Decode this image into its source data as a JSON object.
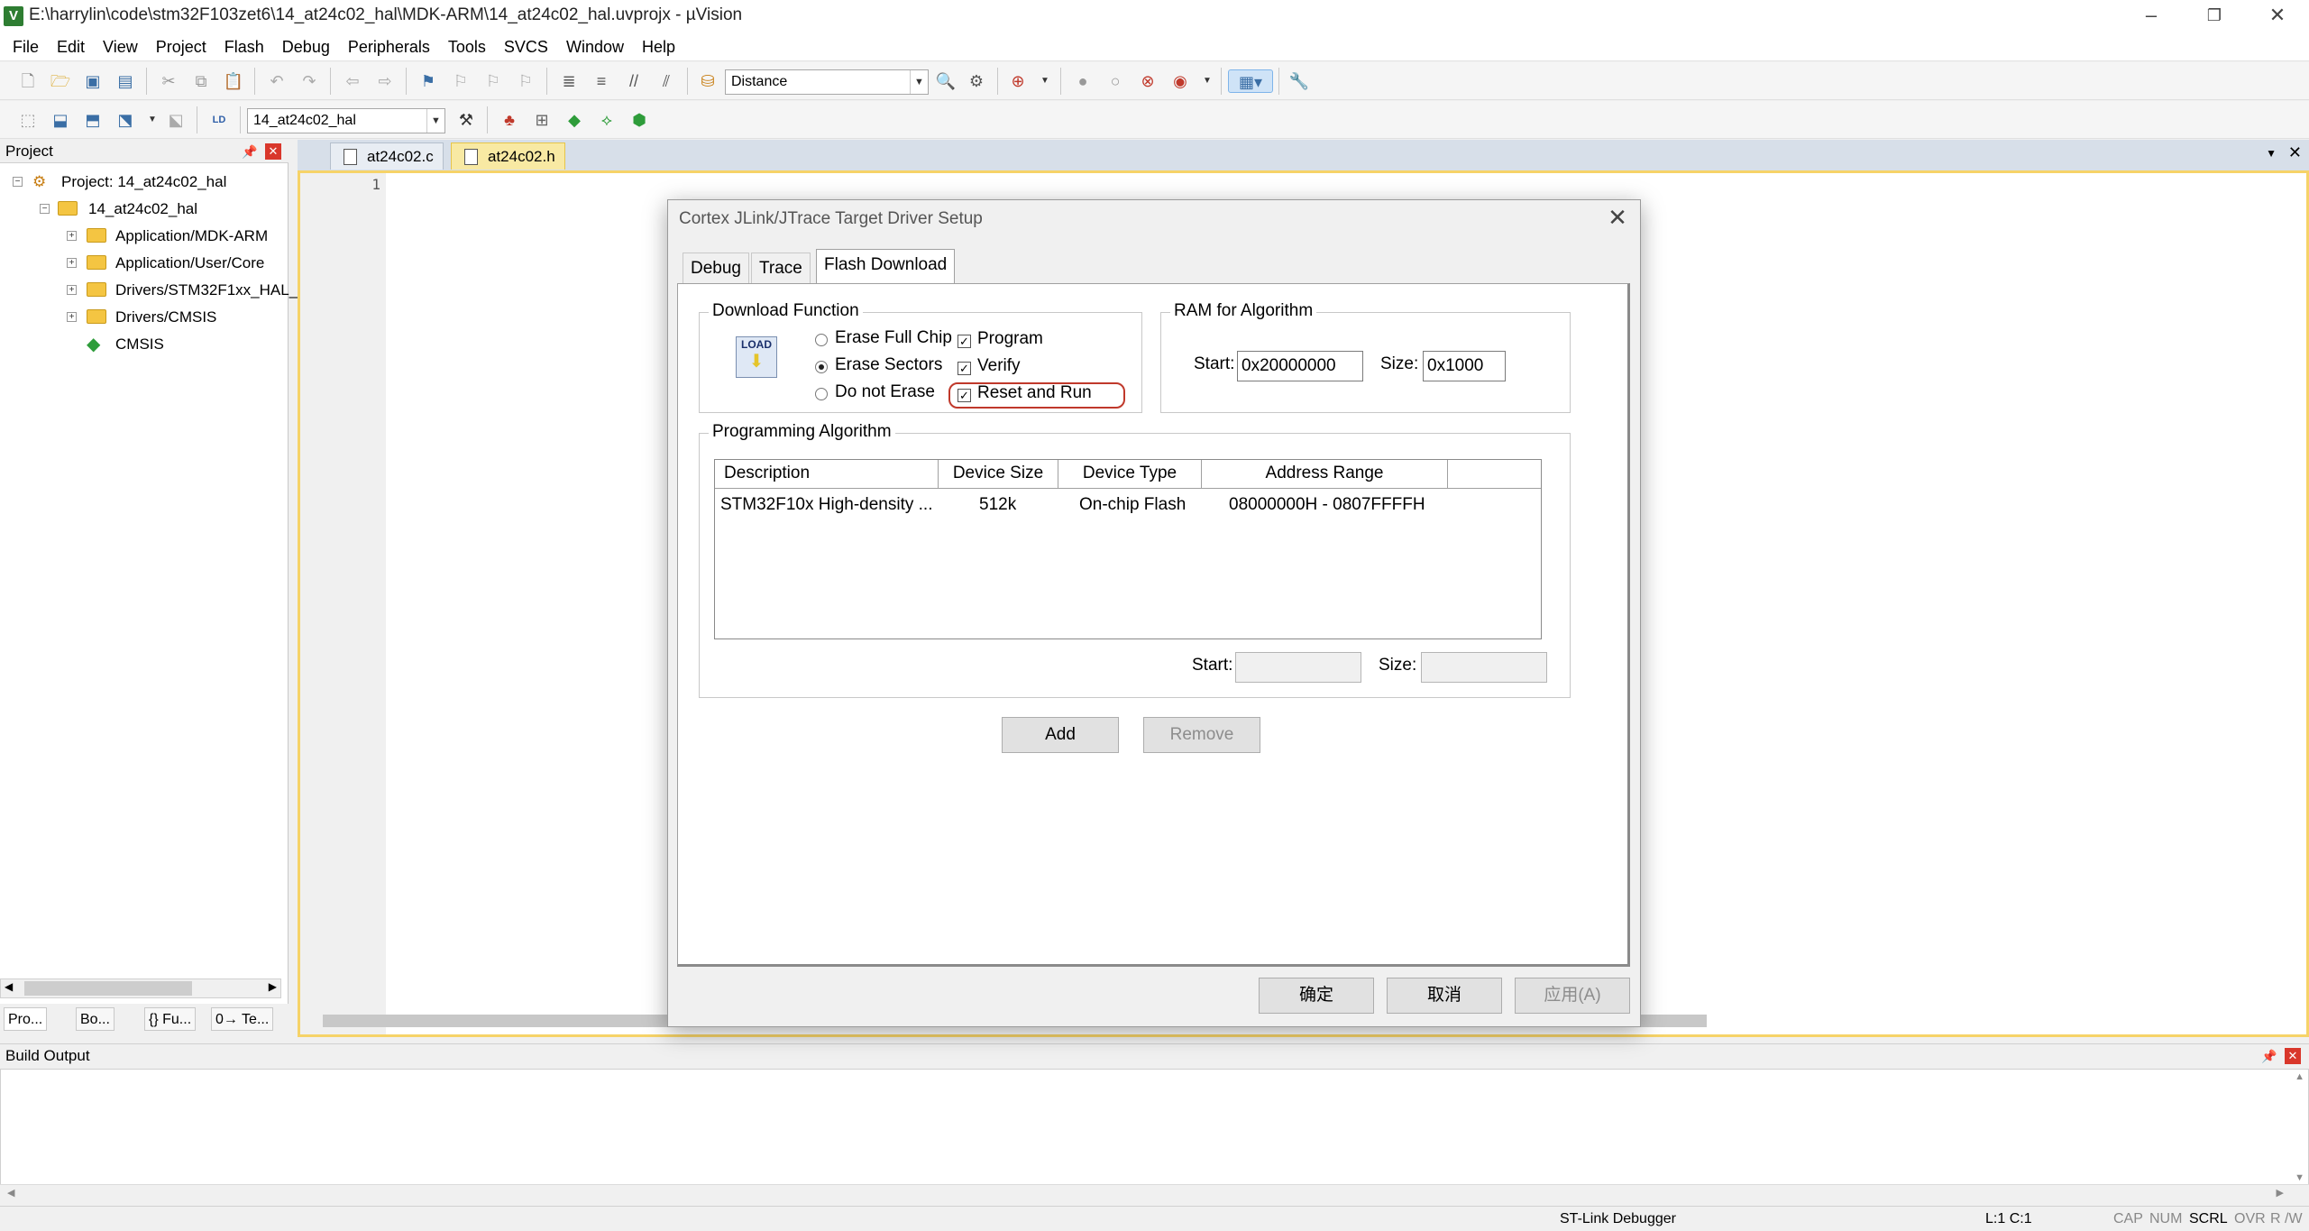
{
  "window": {
    "title": "E:\\harrylin\\code\\stm32F103zet6\\14_at24c02_hal\\MDK-ARM\\14_at24c02_hal.uvprojx - µVision",
    "icon_letter": "V"
  },
  "menu": [
    "File",
    "Edit",
    "View",
    "Project",
    "Flash",
    "Debug",
    "Peripherals",
    "Tools",
    "SVCS",
    "Window",
    "Help"
  ],
  "toolbar": {
    "find_combo": "Distance",
    "target_combo": "14_at24c02_hal"
  },
  "project_panel": {
    "title": "Project",
    "root": "Project: 14_at24c02_hal",
    "target": "14_at24c02_hal",
    "groups": [
      "Application/MDK-ARM",
      "Application/User/Core",
      "Drivers/STM32F1xx_HAL_",
      "Drivers/CMSIS",
      "CMSIS"
    ],
    "tabs": [
      "Pro...",
      "Bo...",
      "{} Fu...",
      "0→ Te..."
    ]
  },
  "editor": {
    "tabs": [
      "at24c02.c",
      "at24c02.h"
    ],
    "active_tab": "at24c02.h",
    "line_number": "1"
  },
  "build_output": {
    "title": "Build Output"
  },
  "status": {
    "debugger": "ST-Link Debugger",
    "position": "L:1 C:1",
    "indicators": [
      "CAP",
      "NUM",
      "SCRL",
      "OVR",
      "R /W"
    ]
  },
  "dialog": {
    "title": "Cortex JLink/JTrace Target Driver Setup",
    "tabs": [
      "Debug",
      "Trace",
      "Flash Download"
    ],
    "active_tab": "Flash Download",
    "download_function": {
      "label": "Download Function",
      "logo_text": "LOAD",
      "erase_options": [
        "Erase Full Chip",
        "Erase Sectors",
        "Do not Erase"
      ],
      "selected_erase": "Erase Sectors",
      "checks": [
        {
          "label": "Program",
          "checked": true
        },
        {
          "label": "Verify",
          "checked": true
        },
        {
          "label": "Reset and Run",
          "checked": true
        }
      ]
    },
    "ram": {
      "label": "RAM for Algorithm",
      "start_label": "Start:",
      "start_value": "0x20000000",
      "size_label": "Size:",
      "size_value": "0x1000"
    },
    "programming_algorithm": {
      "label": "Programming Algorithm",
      "columns": [
        "Description",
        "Device Size",
        "Device Type",
        "Address Range"
      ],
      "rows": [
        [
          "STM32F10x High-density ...",
          "512k",
          "On-chip Flash",
          "08000000H - 0807FFFFH"
        ]
      ],
      "start_label": "Start:",
      "start_value": "",
      "size_label": "Size:",
      "size_value": ""
    },
    "buttons": {
      "add": "Add",
      "remove": "Remove",
      "ok": "确定",
      "cancel": "取消",
      "apply": "应用(A)"
    }
  }
}
